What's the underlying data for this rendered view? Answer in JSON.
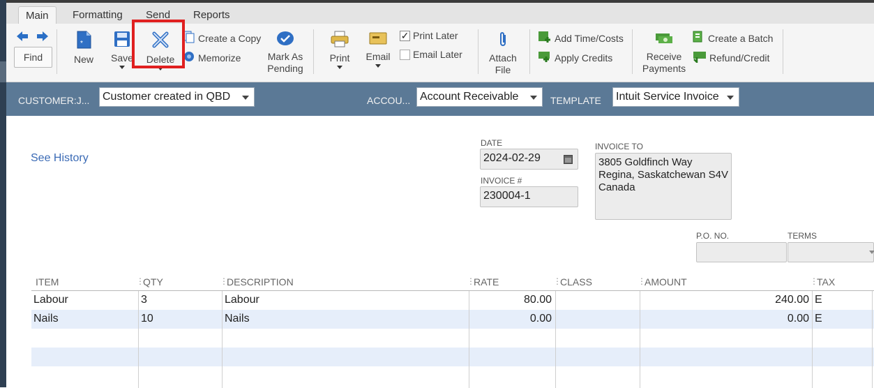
{
  "tabs": [
    "Main",
    "Formatting",
    "Send",
    "Reports"
  ],
  "toolbar": {
    "find": "Find",
    "new": "New",
    "save": "Save",
    "delete": "Delete",
    "create_copy": "Create a Copy",
    "memorize": "Memorize",
    "mark_as": "Mark As",
    "pending": "Pending",
    "print": "Print",
    "email": "Email",
    "print_later": "Print Later",
    "email_later": "Email Later",
    "attach": "Attach",
    "file": "File",
    "add_time_costs": "Add Time/Costs",
    "apply_credits": "Apply Credits",
    "receive": "Receive",
    "payments": "Payments",
    "create_batch": "Create a Batch",
    "refund_credit": "Refund/Credit",
    "print_later_checked": true,
    "email_later_checked": false
  },
  "customer_bar": {
    "customer_label": "CUSTOMER:J...",
    "customer_value": "Customer created in QBD",
    "account_label": "ACCOU...",
    "account_value": "Account Receivable",
    "template_label": "TEMPLATE",
    "template_value": "Intuit Service Invoice"
  },
  "form": {
    "see_history": "See History",
    "date_label": "DATE",
    "date_value": "2024-02-29",
    "invoice_no_label": "INVOICE #",
    "invoice_no_value": "230004-1",
    "invoice_to_label": "INVOICE TO",
    "invoice_to_lines": [
      "3805 Goldfinch Way",
      "Regina, Saskatchewan S4V",
      "Canada"
    ],
    "po_label": "P.O. NO.",
    "terms_label": "TERMS"
  },
  "grid": {
    "columns": [
      "ITEM",
      "QTY",
      "DESCRIPTION",
      "RATE",
      "CLASS",
      "AMOUNT",
      "TAX"
    ],
    "rows": [
      {
        "item": "Labour",
        "qty": "3",
        "description": "Labour",
        "rate": "80.00",
        "class": "",
        "amount": "240.00",
        "tax": "E"
      },
      {
        "item": "Nails",
        "qty": "10",
        "description": "Nails",
        "rate": "0.00",
        "class": "",
        "amount": "0.00",
        "tax": "E"
      }
    ]
  },
  "colors": {
    "customer_bar": "#5b7996",
    "highlight": "#e02020",
    "link": "#3a6ab5",
    "alt_row": "#e6eefa"
  }
}
